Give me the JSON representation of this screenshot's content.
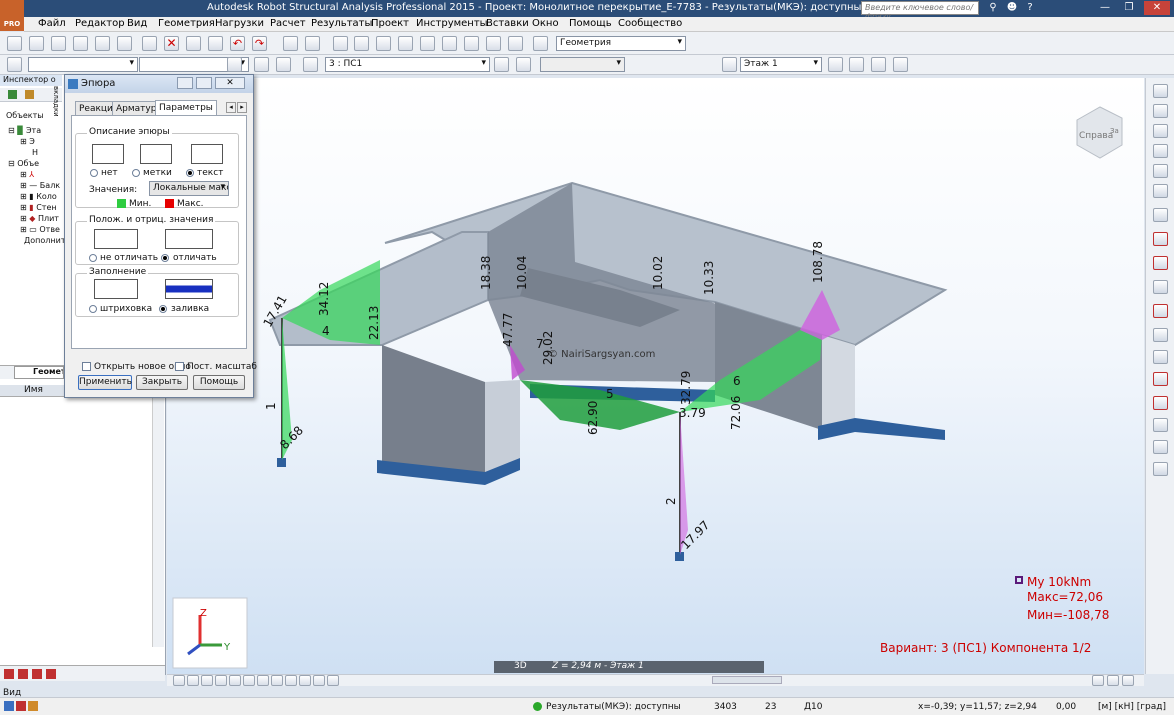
{
  "app": {
    "title": "Autodesk Robot Structural Analysis Professional 2015 - Проект: Монолитное перекрытие_E-7783 - Результаты(МКЭ): доступны",
    "logo_text": "PRO",
    "search_placeholder": "Введите ключевое слово/фразу"
  },
  "menu": [
    "Файл",
    "Редактор",
    "Вид",
    "Геометрия",
    "Нагрузки",
    "Расчет",
    "Результаты",
    "Проект",
    "Инструменты",
    "Вставки",
    "Окно",
    "Помощь",
    "Сообщество"
  ],
  "toolbar": {
    "layout_combo": "Геометрия",
    "case_combo": "3 : ПС1",
    "story_combo": "Этаж 1"
  },
  "inspector": {
    "title": "Инспектор о",
    "side_label": "вкладки",
    "objects_label": "Объекты",
    "tree": [
      "Эта",
      "Э",
      "Н",
      "Объе",
      "Балк",
      "Коло",
      "Стен",
      "Плит",
      "Отве",
      "Дополните"
    ],
    "tab_geometry": "Геомет",
    "name_header": "Имя",
    "bottom_label": "Вид"
  },
  "dialog": {
    "title": "Эпюра",
    "tabs": [
      "Реакции",
      "Арматура",
      "Параметры"
    ],
    "group_description": "Описание эпюры",
    "desc_options": [
      "нет",
      "метки",
      "текст"
    ],
    "values_label": "Значения:",
    "values_select": "Локальные макс",
    "min_label": "Мин.",
    "max_label": "Макс.",
    "group_sign": "Полож. и отриц. значения",
    "sign_options": [
      "не отличать",
      "отличать"
    ],
    "group_fill": "Заполнение",
    "fill_options": [
      "штриховка",
      "заливка"
    ],
    "open_new_window": "Открыть новое окно",
    "const_scale": "Пост. масштаб",
    "btn_apply": "Применить",
    "btn_close": "Закрыть",
    "btn_help": "Помощь",
    "min_color": "#2ecc40",
    "max_color": "#e60000"
  },
  "viewport": {
    "viewcube_label": "Справа",
    "viewcube_label2": "За",
    "watermark": "© NairiSargsyan.com",
    "labels": [
      "17.41",
      "34.12",
      "4",
      "22.13",
      "18.38",
      "10.04",
      "10.02",
      "10.33",
      "108.78",
      "47.77",
      "7",
      "29.02",
      "32.79",
      "5",
      "6",
      "62.90",
      "72.06",
      "3.79",
      "1",
      "8.68",
      "2",
      "17.97"
    ],
    "legend_title": "My 10kNm",
    "legend_max": "Макс=72,06",
    "legend_min": "Мин=-108,78",
    "variant": "Вариант: 3 (ПС1) Компонента 1/2",
    "mode_3d": "3D",
    "z_level": "Z = 2,94 м - Этаж 1",
    "axis_z": "Z",
    "axis_y": "Y"
  },
  "status": {
    "results": "Результаты(МКЭ): доступны",
    "n1": "3403",
    "n2": "23",
    "n3": "Д10",
    "coords": "x=-0,39; y=11,57; z=2,94",
    "value": "0,00",
    "units": "[м] [кН] [град]"
  }
}
